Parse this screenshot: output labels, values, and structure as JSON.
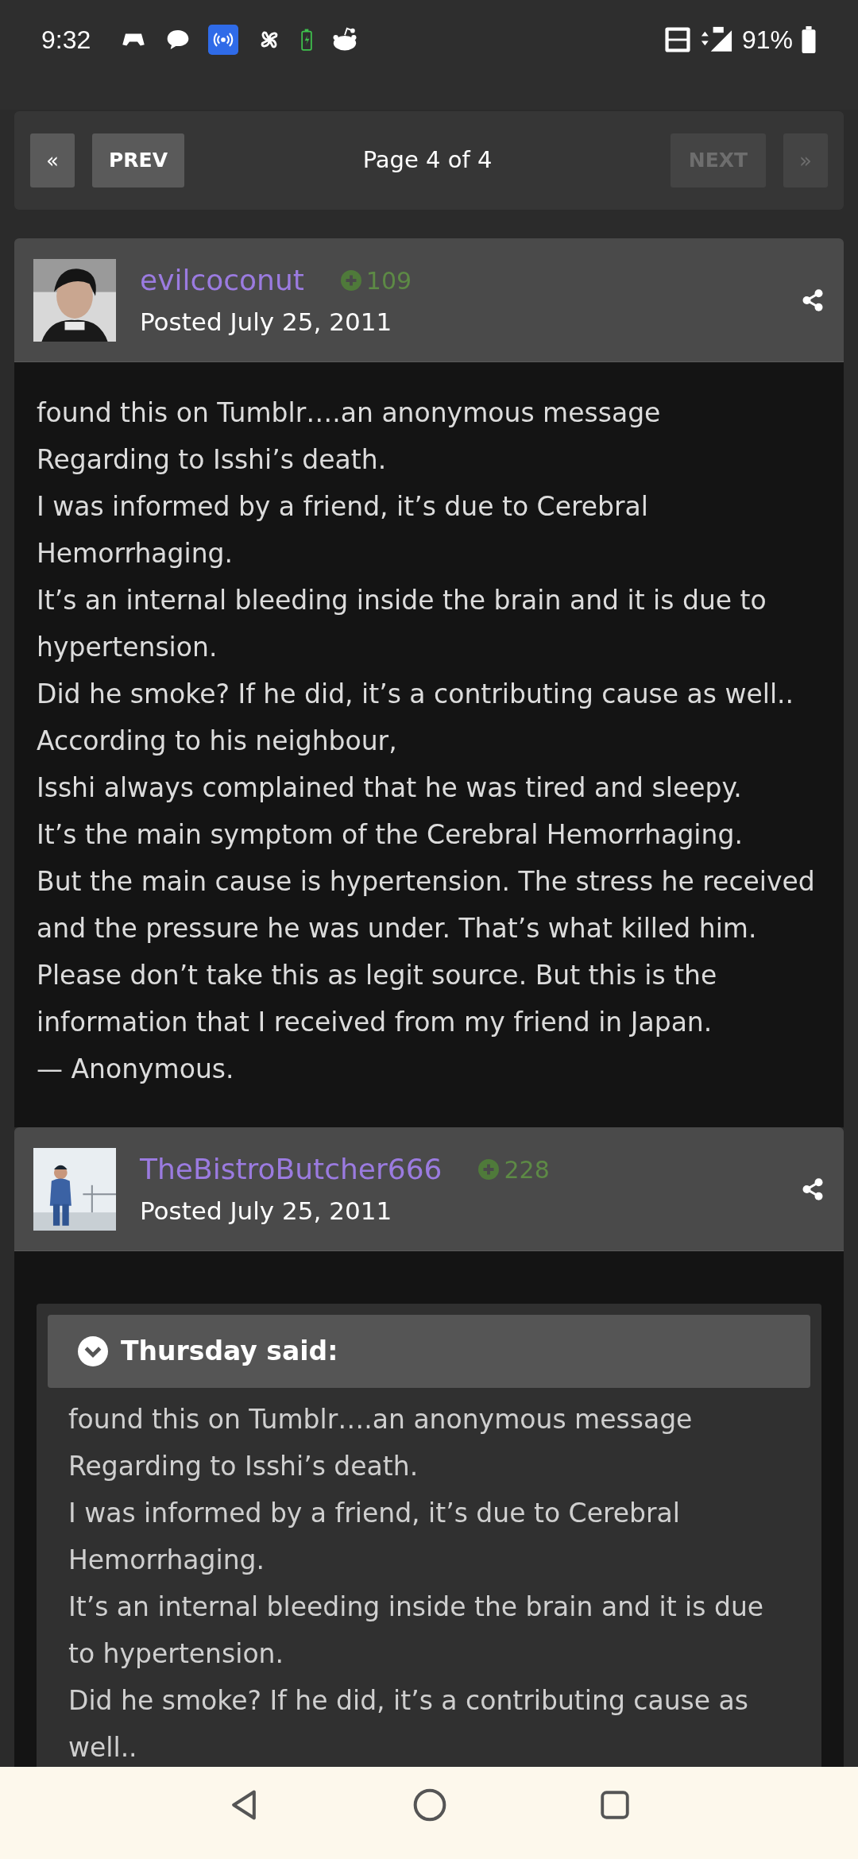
{
  "status_bar": {
    "time": "9:32",
    "battery": "91%"
  },
  "pagination": {
    "first": "«",
    "prev": "PREV",
    "page": "Page 4 of 4",
    "next": "NEXT",
    "last": "»",
    "next_disabled": true
  },
  "posts": [
    {
      "author": "evilcoconut",
      "reputation": "109",
      "posted": "Posted July 25, 2011",
      "body": [
        "found this on Tumblr….an anonymous message",
        "Regarding to Isshi’s death.",
        "I was informed by a friend, it’s due to Cerebral Hemorrhaging.",
        "It’s an internal bleeding inside the brain and it is due to hypertension.",
        "Did he smoke? If he did, it’s a contributing cause as well..",
        "According to his neighbour,",
        "Isshi always complained that he was tired and sleepy.",
        "It’s the main symptom of the Cerebral Hemorrhaging.",
        "But the main cause is hypertension. The stress he received and the pressure he was under. That’s what killed him.",
        "Please don’t take this as legit source. But this is the information that I received from my friend in Japan.",
        "— Anonymous."
      ]
    },
    {
      "author": "TheBistroButcher666",
      "reputation": "228",
      "posted": "Posted July 25, 2011",
      "quote": {
        "title": "Thursday said:",
        "expanded": true,
        "body": [
          "found this on Tumblr….an anonymous message",
          "Regarding to Isshi’s death.",
          "I was informed by a friend, it’s due to Cerebral Hemorrhaging.",
          "It’s an internal bleeding inside the brain and it is due to hypertension.",
          "Did he smoke? If he did, it’s a contributing cause as well.."
        ]
      }
    }
  ]
}
